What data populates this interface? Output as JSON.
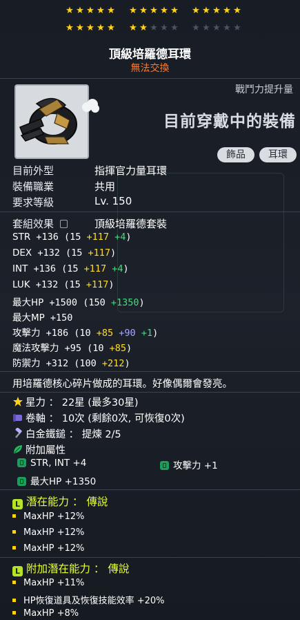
{
  "stars": {
    "filled": 22,
    "max": 30
  },
  "item": {
    "name": "頂級培羅德耳環",
    "trade_status": "無法交換"
  },
  "header_right": {
    "power_label": "戰鬥力提升量",
    "equipped_text": "目前穿戴中的裝備",
    "tags": [
      "飾品",
      "耳環"
    ]
  },
  "info": [
    {
      "label": "目前外型",
      "value": "指揮官力量耳環"
    },
    {
      "label": "裝備職業",
      "value": "共用"
    },
    {
      "label": "要求等級",
      "value": "Lv. 150"
    }
  ],
  "set": {
    "label": "套組效果",
    "value": "頂級培羅德套裝"
  },
  "stats": [
    {
      "name": "STR",
      "total": "+136",
      "base": "15",
      "star": "+117",
      "bonus": "+4"
    },
    {
      "name": "DEX",
      "total": "+132",
      "base": "15",
      "star": "+117",
      "bonus": ""
    },
    {
      "name": "INT",
      "total": "+136",
      "base": "15",
      "star": "+117",
      "bonus": "+4"
    },
    {
      "name": "LUK",
      "total": "+132",
      "base": "15",
      "star": "+117",
      "bonus": ""
    },
    {
      "name": "最大HP",
      "total": "+1500",
      "base": "150",
      "star": "",
      "bonus": "+1350"
    },
    {
      "name": "最大MP",
      "total": "+150",
      "base": "",
      "star": "",
      "bonus": ""
    },
    {
      "name": "攻擊力",
      "total": "+186",
      "base": "10",
      "star": "+85",
      "scroll": "+90",
      "bonus": "+1"
    },
    {
      "name": "魔法攻擊力",
      "total": "+95",
      "base": "10",
      "star": "+85",
      "bonus": ""
    },
    {
      "name": "防禦力",
      "total": "+312",
      "base": "100",
      "star": "+212",
      "bonus": ""
    }
  ],
  "description": "用培羅德核心碎片做成的耳環。好像偶爾會發亮。",
  "extras": {
    "starforce": "星力 ： 22星 (最多30星)",
    "scroll": "卷軸 ： 10次 (剩餘0次, 可恢復0次)",
    "hammer": "白金鐵鎚 ： 提煉 2/5",
    "bonus_title": "附加屬性"
  },
  "bonus_stats": [
    {
      "text": "STR, INT  +4"
    },
    {
      "text": "攻擊力  +1"
    },
    {
      "text": "最大HP  +1350"
    }
  ],
  "potential": {
    "title": "潛在能力 ： 傳說",
    "lines": [
      "MaxHP +12%",
      "MaxHP +12%",
      "MaxHP +12%"
    ]
  },
  "additional_potential": {
    "title": "附加潛在能力 ： 傳說",
    "lines": [
      "MaxHP +11%",
      "HP恢復道具及恢復技能效率 +20%",
      "MaxHP +8%"
    ]
  },
  "colors": {
    "star_on": "#ffd21a",
    "star_off": "#4c535c",
    "trade": "#ff7a2e",
    "star_bonus": "#ffdd2a",
    "flame_bonus": "#3ee07a",
    "scroll_bonus": "#a8a8ff",
    "legendary": "#e6ff3a"
  }
}
